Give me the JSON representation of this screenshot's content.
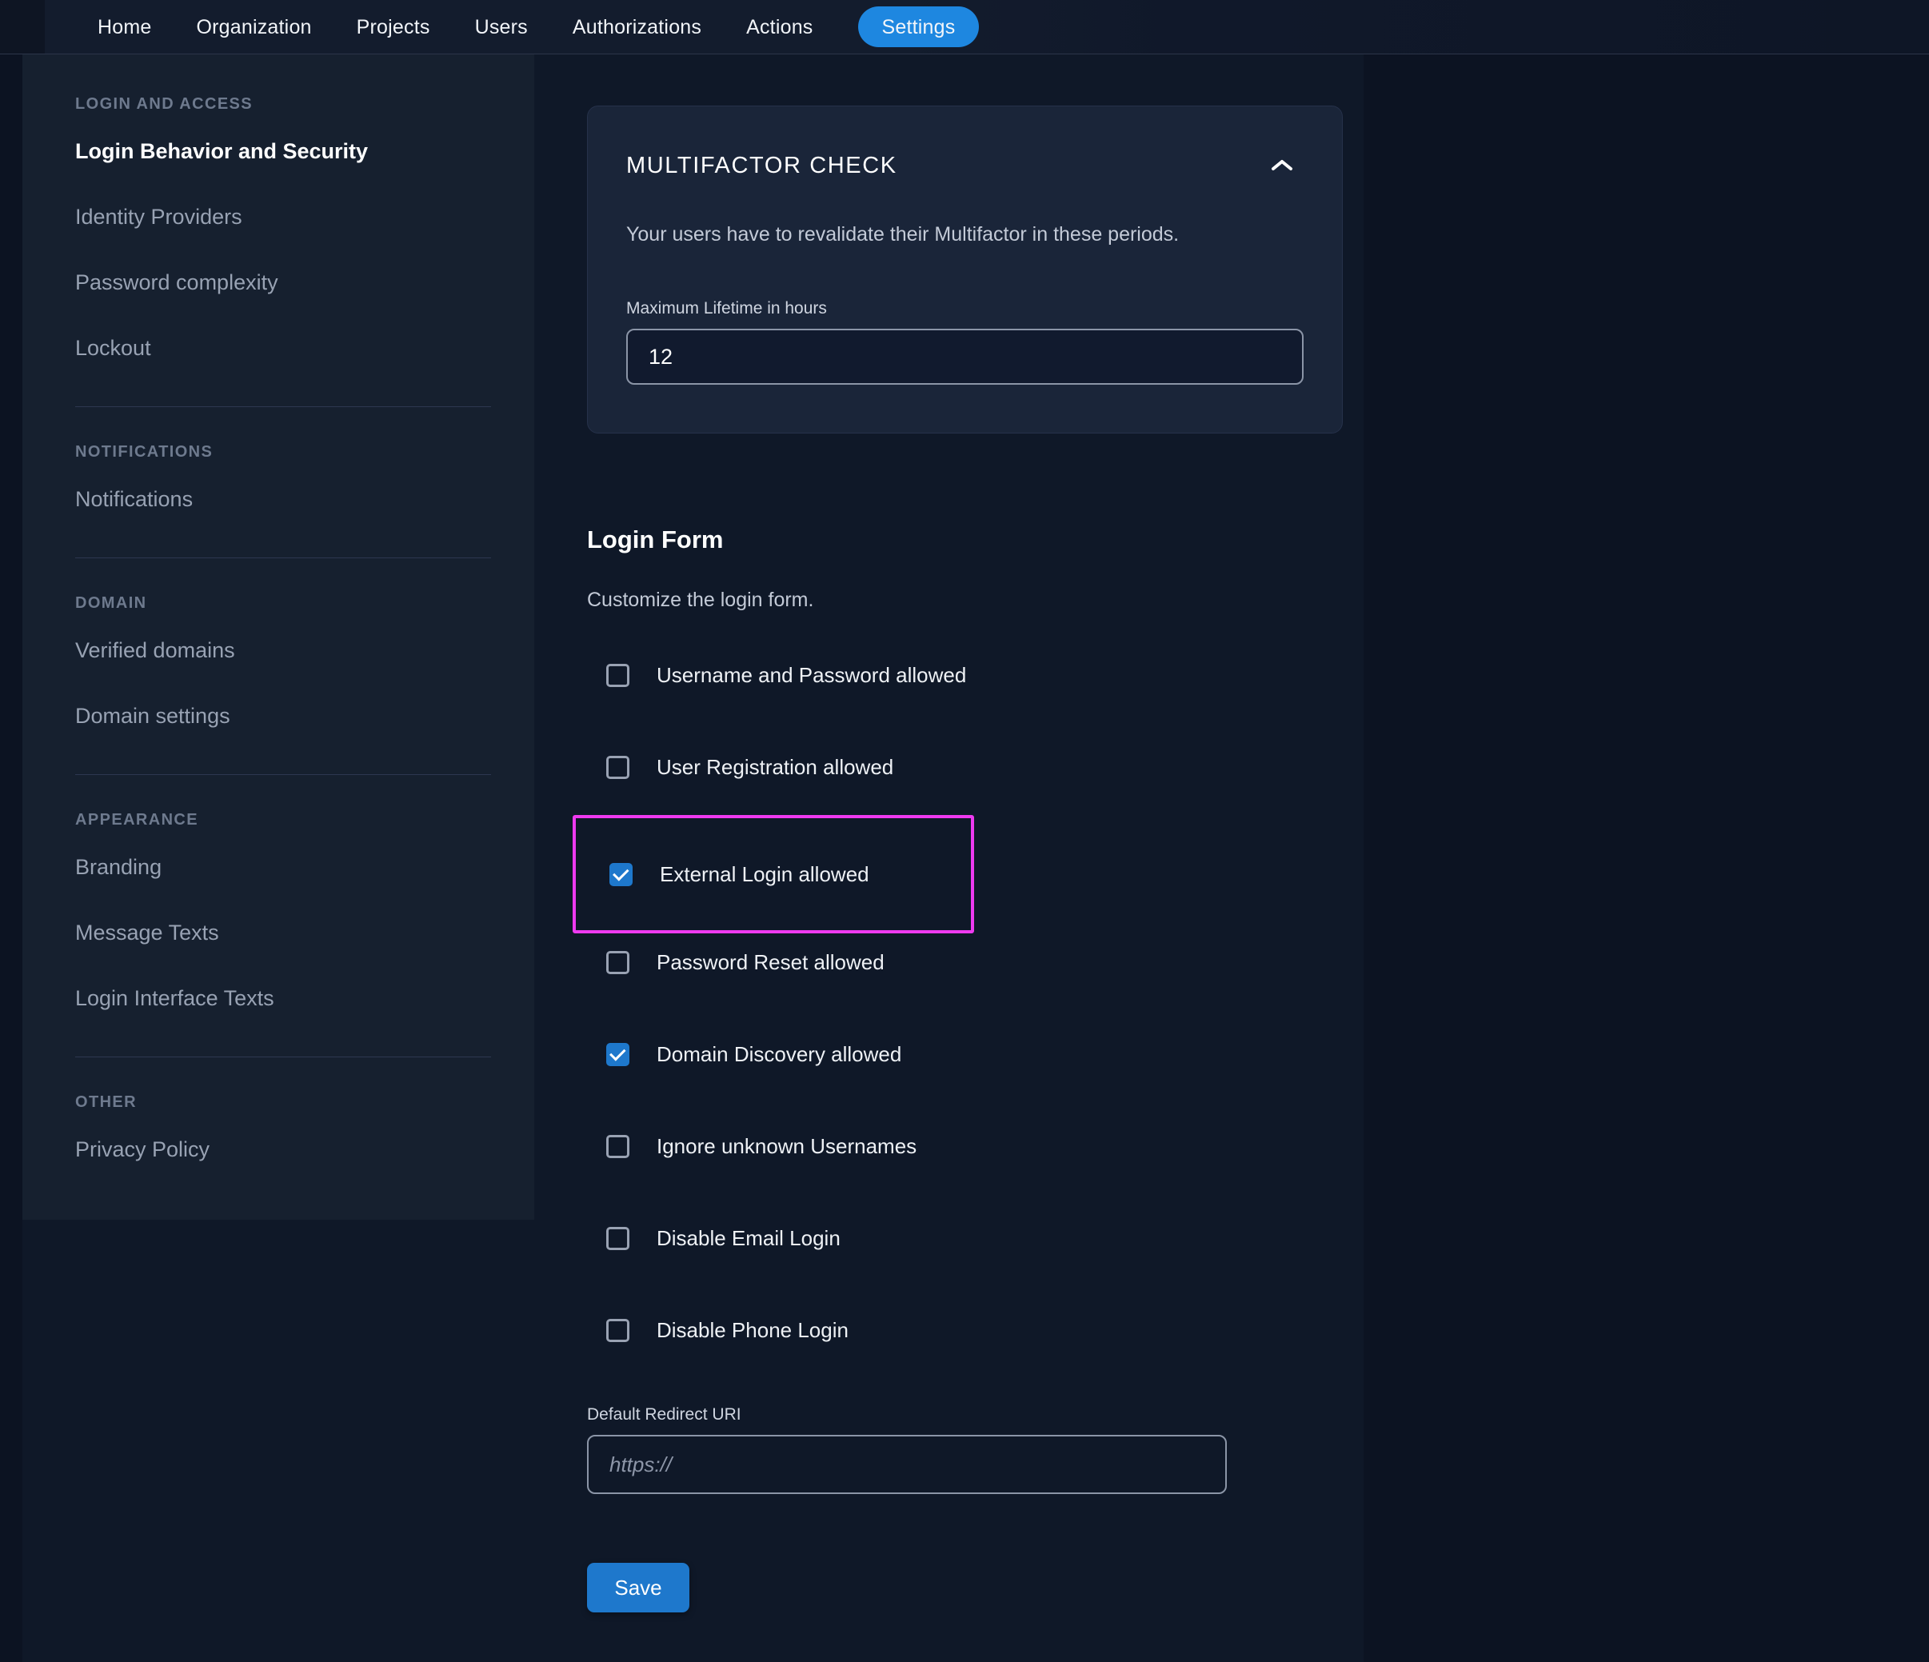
{
  "colors": {
    "accent": "#1e87e0",
    "control": "#1e78cc",
    "highlight": "#ee3af0"
  },
  "nav": {
    "items": [
      {
        "label": "Home",
        "active": false
      },
      {
        "label": "Organization",
        "active": false
      },
      {
        "label": "Projects",
        "active": false
      },
      {
        "label": "Users",
        "active": false
      },
      {
        "label": "Authorizations",
        "active": false
      },
      {
        "label": "Actions",
        "active": false
      },
      {
        "label": "Settings",
        "active": true
      }
    ]
  },
  "sidebar": {
    "sections": [
      {
        "header": "LOGIN AND ACCESS",
        "items": [
          {
            "label": "Login Behavior and Security",
            "active": true
          },
          {
            "label": "Identity Providers",
            "active": false
          },
          {
            "label": "Password complexity",
            "active": false
          },
          {
            "label": "Lockout",
            "active": false
          }
        ]
      },
      {
        "header": "NOTIFICATIONS",
        "items": [
          {
            "label": "Notifications",
            "active": false
          }
        ]
      },
      {
        "header": "DOMAIN",
        "items": [
          {
            "label": "Verified domains",
            "active": false
          },
          {
            "label": "Domain settings",
            "active": false
          }
        ]
      },
      {
        "header": "APPEARANCE",
        "items": [
          {
            "label": "Branding",
            "active": false
          },
          {
            "label": "Message Texts",
            "active": false
          },
          {
            "label": "Login Interface Texts",
            "active": false
          }
        ]
      },
      {
        "header": "OTHER",
        "items": [
          {
            "label": "Privacy Policy",
            "active": false
          }
        ]
      }
    ]
  },
  "multifactor_card": {
    "title": "MULTIFACTOR CHECK",
    "description": "Your users have to revalidate their Multifactor in these periods.",
    "lifetime_label": "Maximum Lifetime in hours",
    "lifetime_value": "12",
    "collapse_icon": "chevron-up"
  },
  "login_form": {
    "title": "Login Form",
    "description": "Customize the login form.",
    "checkboxes": [
      {
        "label": "Username and Password allowed",
        "checked": false,
        "highlighted": false
      },
      {
        "label": "User Registration allowed",
        "checked": false,
        "highlighted": false
      },
      {
        "label": "External Login allowed",
        "checked": true,
        "highlighted": true
      },
      {
        "label": "Password Reset allowed",
        "checked": false,
        "highlighted": false
      },
      {
        "label": "Domain Discovery allowed",
        "checked": true,
        "highlighted": false
      },
      {
        "label": "Ignore unknown Usernames",
        "checked": false,
        "highlighted": false
      },
      {
        "label": "Disable Email Login",
        "checked": false,
        "highlighted": false
      },
      {
        "label": "Disable Phone Login",
        "checked": false,
        "highlighted": false
      }
    ],
    "redirect_label": "Default Redirect URI",
    "redirect_placeholder": "https://",
    "save_label": "Save"
  }
}
